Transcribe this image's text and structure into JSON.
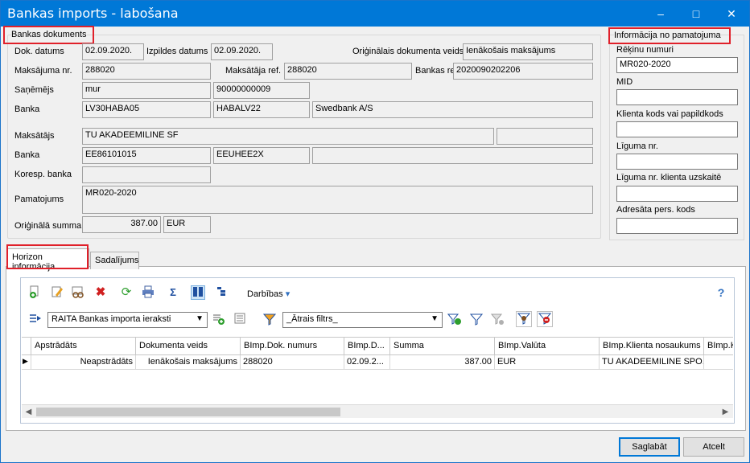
{
  "window": {
    "title": "Bankas imports - labošana",
    "minimize": "–",
    "maximize": "□",
    "close": "✕"
  },
  "bank_doc": {
    "group_title": "Bankas dokuments",
    "dok_datums_label": "Dok. datums",
    "dok_datums": "02.09.2020.",
    "izpildes_datums_label": "Izpildes datums",
    "izpildes_datums": "02.09.2020.",
    "orig_doc_veids_label": "Oriģinālais dokumenta veids",
    "orig_doc_veids": "Ienākošais maksājums",
    "maksajuma_nr_label": "Maksājuma nr.",
    "maksajuma_nr": "288020",
    "maksataja_ref_label": "Maksātāja ref.",
    "maksataja_ref": "288020",
    "bankas_ref_label": "Bankas ref.",
    "bankas_ref": "2020090202206",
    "sanemejs_label": "Saņēmējs",
    "sanemejs": "mur",
    "sanemejs_code": "90000000009",
    "banka_label": "Banka",
    "banka_account": "LV30HABA05",
    "banka_swift": "HABALV22",
    "banka_name": "Swedbank A/S",
    "maksatajs_label": "Maksātājs",
    "maksatajs": "TU AKADEEMILINE SF",
    "maksatajs_extra": "",
    "banka2_label": "Banka",
    "banka2_account": "EE86101015",
    "banka2_swift": "EEUHEE2X",
    "banka2_name": "",
    "koresp_label": "Koresp. banka",
    "koresp": "",
    "pamatojums_label": "Pamatojums",
    "pamatojums": "MR020-2020",
    "orig_summa_label": "Oriģinālā summa",
    "orig_summa": "387.00",
    "orig_valuta": "EUR"
  },
  "pamatojums_info": {
    "group_title": "Informācija no pamatojuma",
    "rekinu_label": "Rēķinu numuri",
    "rekinu": "MR020-2020",
    "mid_label": "MID",
    "mid": "",
    "klienta_kods_label": "Klienta kods vai papildkods",
    "klienta_kods": "",
    "liguma_label": "Līguma nr.",
    "liguma": "",
    "liguma_klienta_label": "Līguma nr. klienta uzskaitē",
    "liguma_klienta": "",
    "adresata_label": "Adresāta pers. kods",
    "adresata": ""
  },
  "tabs": {
    "horizon": "Horizon informācija",
    "sadalijums": "Sadalījums"
  },
  "toolbar": {
    "darbibas": "Darbības",
    "query_select": "RAITA Bankas importa ieraksti",
    "filter_select": "_Ātrais filtrs_",
    "icons": [
      "new-icon",
      "edit-icon",
      "view-icon",
      "delete-icon",
      "refresh-icon",
      "print-icon",
      "sum-icon",
      "columns-icon",
      "tree-icon",
      "help-icon"
    ]
  },
  "grid": {
    "columns": [
      "Apstrādāts",
      "Dokumenta veids",
      "BImp.Dok. numurs",
      "BImp.D...",
      "Summa",
      "BImp.Valūta",
      "BImp.Klienta nosaukums",
      "BImp.K"
    ],
    "rows": [
      [
        "Neapstrādāts",
        "Ienākošais maksājums",
        "288020",
        "02.09.2...",
        "387.00",
        "EUR",
        "TU AKADEEMILINE SPO...",
        ""
      ]
    ]
  },
  "buttons": {
    "save": "Saglabāt",
    "cancel": "Atcelt"
  },
  "colors": {
    "titlebar": "#0078d7",
    "highlight": "#e0202a"
  }
}
